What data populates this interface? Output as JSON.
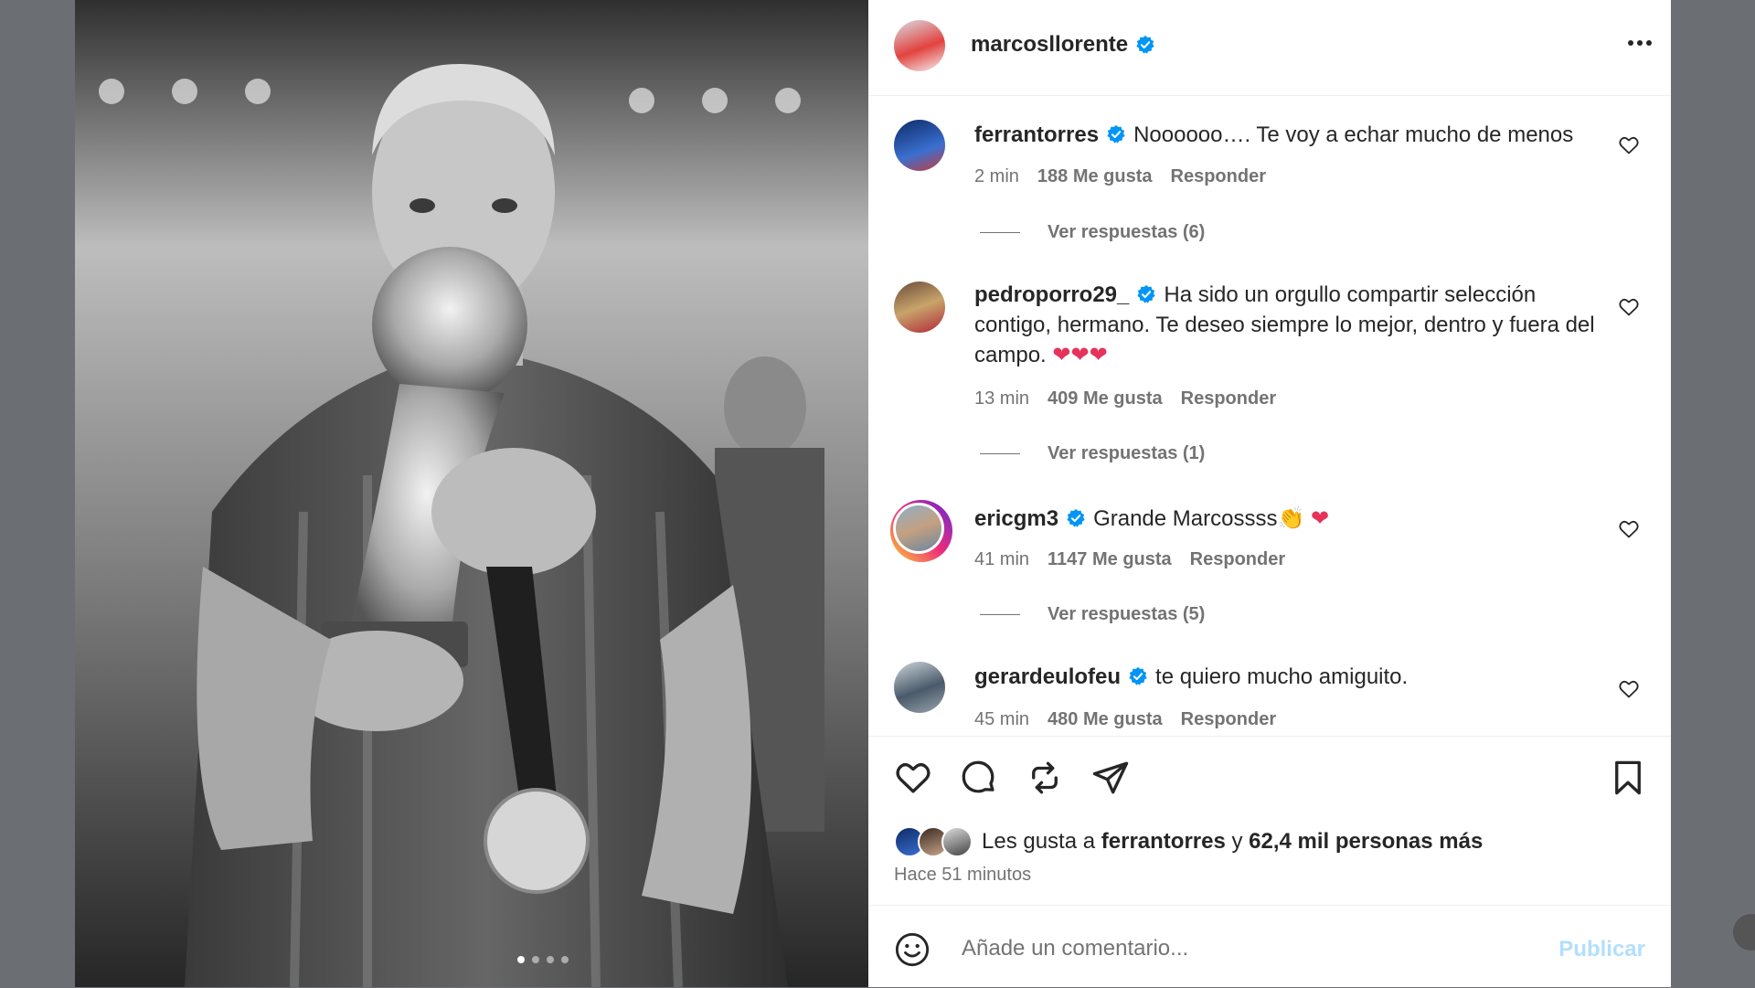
{
  "post": {
    "author": "marcosllorente",
    "author_verified": true,
    "carousel": {
      "dots": 4,
      "active_index": 0
    }
  },
  "comments": [
    {
      "user": "ferrantorres",
      "verified": true,
      "text": "Noooooo…. Te voy a echar mucho de menos",
      "time": "2 min",
      "likes": "188 Me gusta",
      "reply": "Responder",
      "view_replies": "Ver respuestas (6)"
    },
    {
      "user": "pedroporro29_",
      "verified": true,
      "text": "Ha sido un orgullo compartir selección contigo, hermano. Te deseo siempre lo mejor, dentro y fuera del campo.",
      "emojis": "❤❤❤",
      "time": "13 min",
      "likes": "409 Me gusta",
      "reply": "Responder",
      "view_replies": "Ver respuestas (1)"
    },
    {
      "user": "ericgm3",
      "verified": true,
      "text": "Grande Marcossss",
      "emojis": "👏 ❤",
      "time": "41 min",
      "likes": "1147 Me gusta",
      "reply": "Responder",
      "view_replies": "Ver respuestas (5)"
    },
    {
      "user": "gerardeulofeu",
      "verified": true,
      "text": "te quiero mucho amiguito.",
      "time": "45 min",
      "likes": "480 Me gusta",
      "reply": "Responder"
    }
  ],
  "likes_summary": {
    "prefix": "Les gusta a",
    "user": "ferrantorres",
    "conj": "y",
    "others": "62,4 mil personas más"
  },
  "time_ago": "Hace 51 minutos",
  "add_comment": {
    "placeholder": "Añade un comentario...",
    "publish": "Publicar"
  },
  "colors": {
    "verified": "#0095f6",
    "publish_disabled": "#b2dffc",
    "heart": "#e6335b"
  }
}
